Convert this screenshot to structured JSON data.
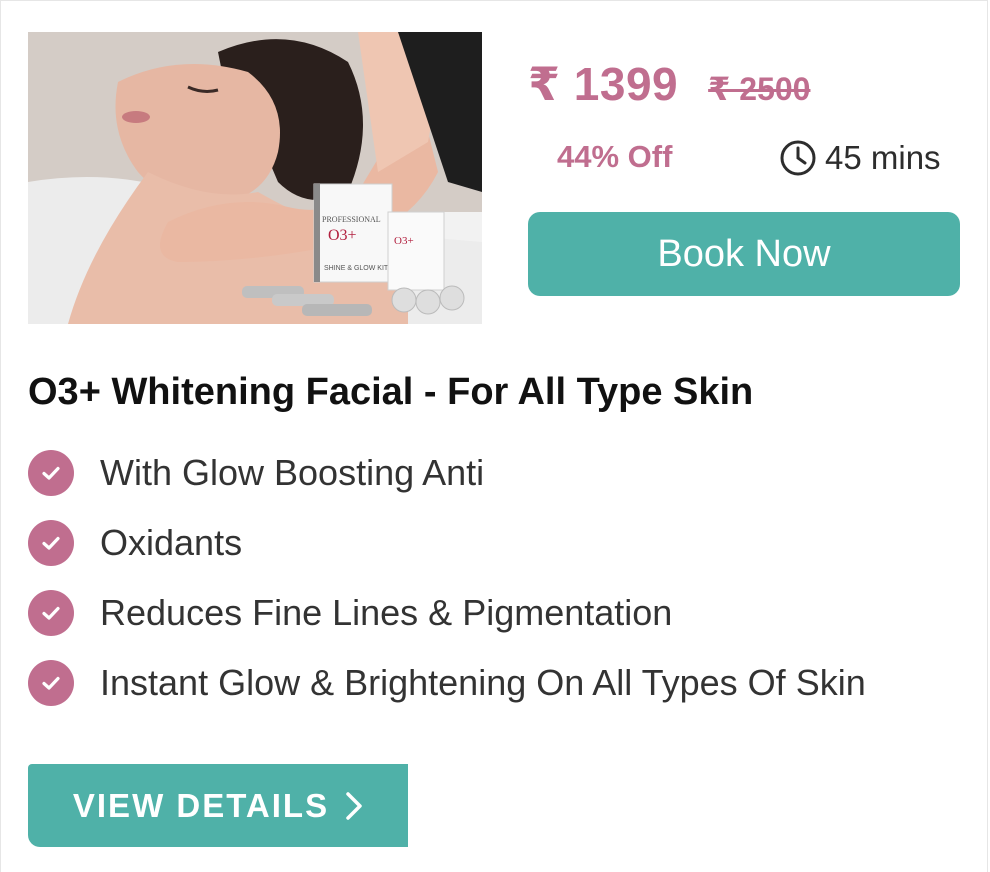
{
  "product": {
    "title": "O3+ Whitening Facial - For All Type Skin",
    "price": "₹ 1399",
    "original_price": "₹ 2500",
    "discount": "44% Off",
    "duration": "45 mins",
    "image_alt": "Woman receiving facial massage with O3+ Shine & Glow kit",
    "image_text": {
      "kit_brand": "PROFESSIONAL",
      "kit_logo": "O3+",
      "kit_name": "SHINE & GLOW KIT"
    }
  },
  "actions": {
    "book_label": "Book Now",
    "details_label": "VIEW DETAILS"
  },
  "features": [
    "With Glow Boosting Anti",
    "Oxidants",
    "Reduces Fine Lines & Pigmentation",
    "Instant Glow & Brightening On All Types Of Skin"
  ],
  "colors": {
    "accent_pink": "#c06e8f",
    "button_teal": "#4fb1a8",
    "text_dark": "#111111"
  },
  "icons": {
    "duration": "clock-icon",
    "feature_bullet": "check-circle-icon",
    "details_arrow": "chevron-right-icon"
  }
}
